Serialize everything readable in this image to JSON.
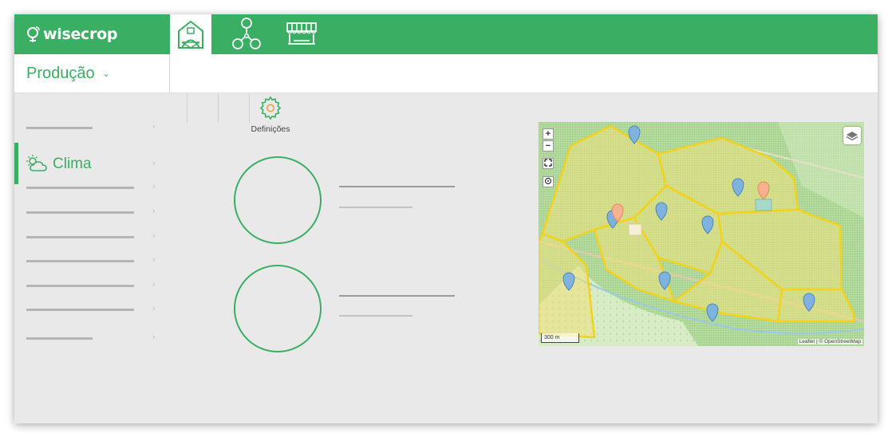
{
  "app": {
    "logo_text": "wisecrop",
    "nav": [
      {
        "icon": "greenhouse-icon",
        "active": true
      },
      {
        "icon": "network-nodes-icon",
        "active": false
      },
      {
        "icon": "market-stall-icon",
        "active": false
      }
    ]
  },
  "section": {
    "label": "Produção",
    "chevron": "⌄"
  },
  "sidebar": {
    "active_item": {
      "label": "Clima",
      "icon": "weather-cloud-sun-icon"
    },
    "arrow": "›"
  },
  "toolbar": {
    "settings_label": "Definições",
    "settings_icon": "gear-icon"
  },
  "map": {
    "zoom_in": "+",
    "zoom_out": "−",
    "scale_label": "300 m",
    "attribution": "Leaflet | © OpenStreetMap"
  },
  "colors": {
    "brand": "#3aae63",
    "field_fill": "#f1e27a",
    "field_border": "#f2d21b",
    "marker": "#7fb2dd",
    "marker_alt": "#f5b190"
  }
}
